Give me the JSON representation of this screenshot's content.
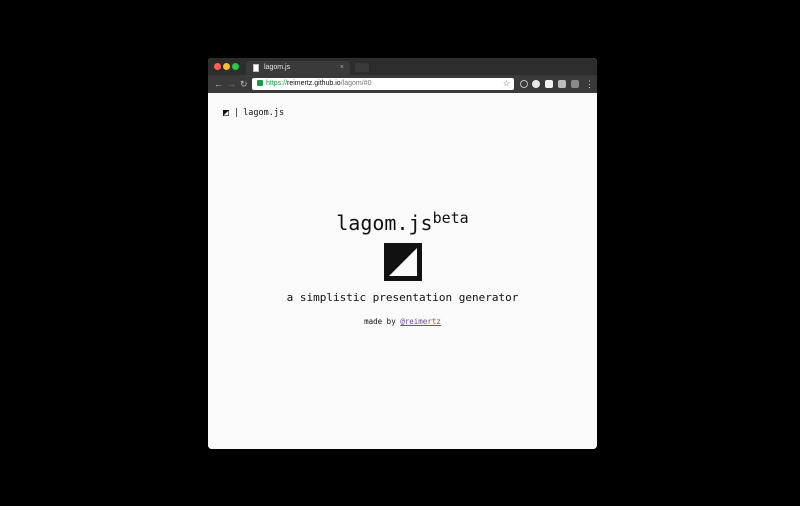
{
  "browser": {
    "tab_title": "lagom.js",
    "tab_close": "×",
    "url_scheme": "https://",
    "url_host": "reimertz.github.io",
    "url_path": "/lagom/#0",
    "colors": {
      "close": "#fd5f57",
      "minimize": "#fdbc2e",
      "maximize": "#28c840",
      "secure": "#1a9d42"
    }
  },
  "page": {
    "header_separator": "|",
    "header_text": "lagom.js",
    "title": "lagom.js",
    "title_sup": "beta",
    "subtitle": "a simplistic presentation generator",
    "credit_prefix": "made by",
    "credit_link": "@reimertz",
    "colors": {
      "background": "#fafafa",
      "text": "#111111",
      "link": "#6a4bb5"
    }
  },
  "icons": {
    "logo": "half-diagonal-square-icon",
    "back": "arrow-left-icon",
    "forward": "arrow-right-icon",
    "reload": "reload-icon",
    "bookmark": "star-icon",
    "menu": "vertical-dots-icon"
  }
}
